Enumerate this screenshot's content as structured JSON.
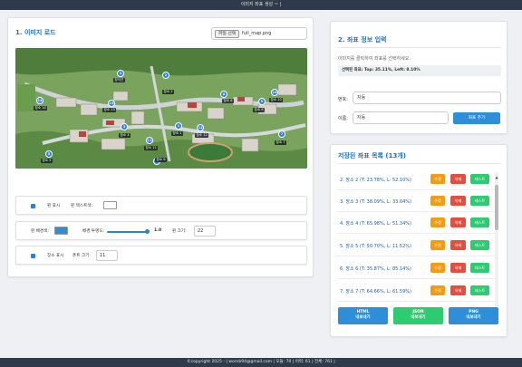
{
  "window": {
    "title": "이미지 좌표 생성 ~ |"
  },
  "left_panel": {
    "title": "1. 이미지 로드",
    "file_button": "파일 선택",
    "file_name": "full_map.png",
    "markers": [
      {
        "num": "4",
        "label": "창석관"
      },
      {
        "num": "2",
        "label": "장소 2"
      },
      {
        "num": "8",
        "label": "장소 8"
      },
      {
        "num": "9",
        "label": "장소 9"
      },
      {
        "num": "10",
        "label": "장소 10"
      },
      {
        "num": "14",
        "label": "장소 14"
      },
      {
        "num": "13",
        "label": "장소 13"
      },
      {
        "num": "11",
        "label": "장소 11"
      },
      {
        "num": "12",
        "label": "장소 12"
      },
      {
        "num": "3",
        "label": "장소 3"
      },
      {
        "num": "7",
        "label": "장소 7"
      },
      {
        "num": "6",
        "label": "장소 6"
      },
      {
        "num": "5",
        "label": "장소 5"
      },
      {
        "num": "1",
        "label": "장소 1"
      }
    ],
    "controls": {
      "show_pins": "핀 표시",
      "pin_text_color": "핀 텍스트색:",
      "pin_bg_color": "핀 배경색:",
      "bg_opacity": "배경 투명도:",
      "opacity_value": "1.0",
      "opacity": 1.0,
      "pin_size_label": "핀 크기:",
      "pin_size": "22",
      "show_places": "장소 표시",
      "font_size_label": "폰트 크기:",
      "font_size": "11"
    }
  },
  "coord_panel": {
    "title": "2. 좌표 정보 입력",
    "hint": "이미지를 클릭하여 좌표를 선택하세요.",
    "selected": "선택된 좌표: Top: 35.11%, Left: 8.10%",
    "number_label": "번호:",
    "number_value": "자동",
    "name_label": "이름:",
    "name_value": "자동",
    "add_button": "좌표 추가"
  },
  "saved_panel": {
    "title": "저장된 좌표 목록 (13개)",
    "edit": "수정",
    "delete": "삭제",
    "test": "테스트",
    "rows": [
      "2. 장소 2 (T: 23.78%, L: 52.10%)",
      "3. 장소 3 (T: 38.09%, L: 33.04%)",
      "4. 장소 4 (T: 65.98%, L: 51.34%)",
      "5. 장소 5 (T: 50.70%, L: 11.52%)",
      "6. 장소 6 (T: 35.87%, L: 85.14%)",
      "7. 장소 7 (T: 64.66%, L: 61.59%)"
    ],
    "export_html": {
      "line1": "HTML",
      "line2": "내보내기"
    },
    "export_json": {
      "line1": "JSON",
      "line2": "내보내기"
    },
    "export_png": {
      "line1": "PNG",
      "line2": "내보내기"
    }
  },
  "footer": {
    "text": "©copyright 2025 - | wornb94@gmail.com | 모듈: 70 | 이력: 61 | 전체: 761 |"
  },
  "colors": {
    "accent": "#1b74c4",
    "button_blue": "#2f8ed8",
    "edit": "#f39c12",
    "delete": "#e74c3c",
    "test": "#2ecc71",
    "pin_bg": "#2f7fd6"
  }
}
